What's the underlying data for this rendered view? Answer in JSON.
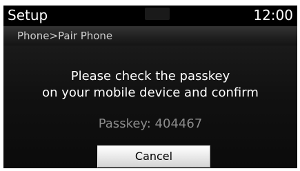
{
  "header": {
    "title": "Setup",
    "clock": "12:00"
  },
  "breadcrumb": "Phone>Pair Phone",
  "dialog": {
    "message_line1": "Please check the passkey",
    "message_line2": "on your mobile device and confirm",
    "passkey": "Passkey: 404467",
    "cancel_label": "Cancel"
  },
  "colors": {
    "background": "#000000",
    "text": "#ffffff",
    "passkey_text": "#8c8c8c",
    "button_face": "#e6e6e6"
  }
}
